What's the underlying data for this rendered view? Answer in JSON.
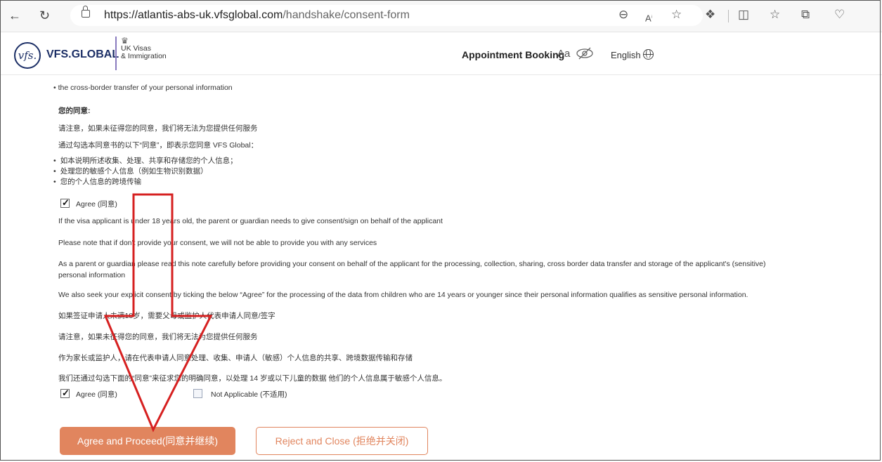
{
  "browser": {
    "url_host": "https://atlantis-abs-uk.vfsglobal.com",
    "url_path": "/handshake/consent-form",
    "icons": [
      "back-icon",
      "refresh-icon",
      "lock-icon",
      "zoom-out-icon",
      "read-aloud-icon",
      "favorite-star-icon",
      "extensions-icon",
      "split-screen-icon",
      "favorites-icon",
      "collections-icon",
      "browser-essentials-icon"
    ]
  },
  "header": {
    "logo_glyph": "vfs.",
    "brand": "VFS.GLOBAL",
    "uk_line1": "UK Visas",
    "uk_line2": "& Immigration",
    "appointment_booking": "Appointment Booking",
    "font_toggle": "Aa",
    "language": "English"
  },
  "content": {
    "en_bullet_partial": "• the cross-border transfer of your personal information",
    "cn_heading": "您的同意:",
    "cn_note": "请注意，如果未征得您的同意，我们将无法为您提供任何服务",
    "cn_intro": "通过勾选本同意书的以下“同意”，即表示您同意 VFS Global：",
    "cn_bullets": [
      "如本说明所述收集、处理、共享和存储您的个人信息；",
      "处理您的敏感个人信息（例如生物识别数据）",
      "您的个人信息的跨境传输"
    ],
    "agree_1_label": "Agree (同意)",
    "agree_1_checked": true,
    "para_minor": "If the visa applicant is under 18 years old, the parent or guardian needs to give consent/sign on behalf of the applicant",
    "para_noconsent": "Please note that if don't provide your consent, we will not be able to provide you with any services",
    "para_guardian_1": "As a parent or guardian please read this note carefully before providing your consent on behalf of the applicant for the processing, collection, sharing, cross border data transfer and storage of the applicant's (sensitive)",
    "para_guardian_2": "personal information",
    "para_explicit": "We also seek your explicit consent by ticking the below “Agree” for the processing of the data from children who are 14 years or younger since their personal information qualifies as sensitive personal information.",
    "cn_minor": "如果签证申请人未满18岁，需要父母或监护人代表申请人同意/签字",
    "cn_noconsent": "请注意，如果未征得您的同意，我们将无法为您提供任何服务",
    "cn_guardian": "作为家长或监护人，请在代表申请人同意处理、收集、申请人（敏感）个人信息的共享、跨境数据传输和存储",
    "cn_explicit": "我们还通过勾选下面的“同意”来征求您的明确同意，以处理 14 岁或以下儿童的数据 他们的个人信息属于敏感个人信息。",
    "agree_2_label": "Agree (同意)",
    "agree_2_checked": true,
    "na_label": "Not Applicable (不适用)",
    "na_checked": false
  },
  "buttons": {
    "proceed": "Agree and Proceed(同意并继续)",
    "reject": "Reject and Close (拒绝并关闭)"
  },
  "colors": {
    "brand_navy": "#1c2f66",
    "accent_orange": "#e1855e",
    "annotation_red": "#d62020"
  }
}
